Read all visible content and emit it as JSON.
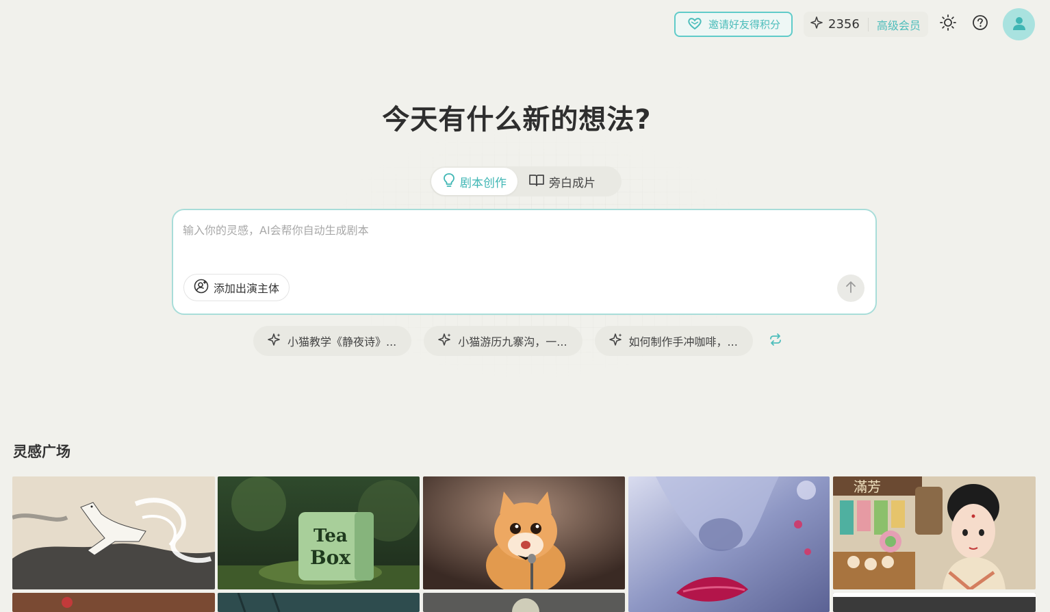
{
  "header": {
    "invite_label": "邀请好友得积分",
    "credits": "2356",
    "membership": "高级会员"
  },
  "hero": {
    "title": "今天有什么新的想法?"
  },
  "modes": [
    {
      "label": "剧本创作",
      "active": true
    },
    {
      "label": "旁白成片",
      "active": false
    }
  ],
  "prompt": {
    "placeholder": "输入你的灵感，AI会帮你自动生成剧本",
    "value": "",
    "add_cast_label": "添加出演主体"
  },
  "suggestions": [
    {
      "label": "小猫教学《静夜诗》..."
    },
    {
      "label": "小猫游历九寨沟，一..."
    },
    {
      "label": "如何制作手冲咖啡，..."
    }
  ],
  "gallery": {
    "title": "灵感广场",
    "cards": [
      {
        "name": "white-fox-ink-painting"
      },
      {
        "name": "tea-box-product"
      },
      {
        "name": "singing-cat"
      },
      {
        "name": "iridescent-face-lips"
      },
      {
        "name": "hanfu-girl-market",
        "sign_text": "滿芳"
      }
    ]
  },
  "colors": {
    "accent": "#4dbdbb",
    "background": "#f1f1ec"
  }
}
